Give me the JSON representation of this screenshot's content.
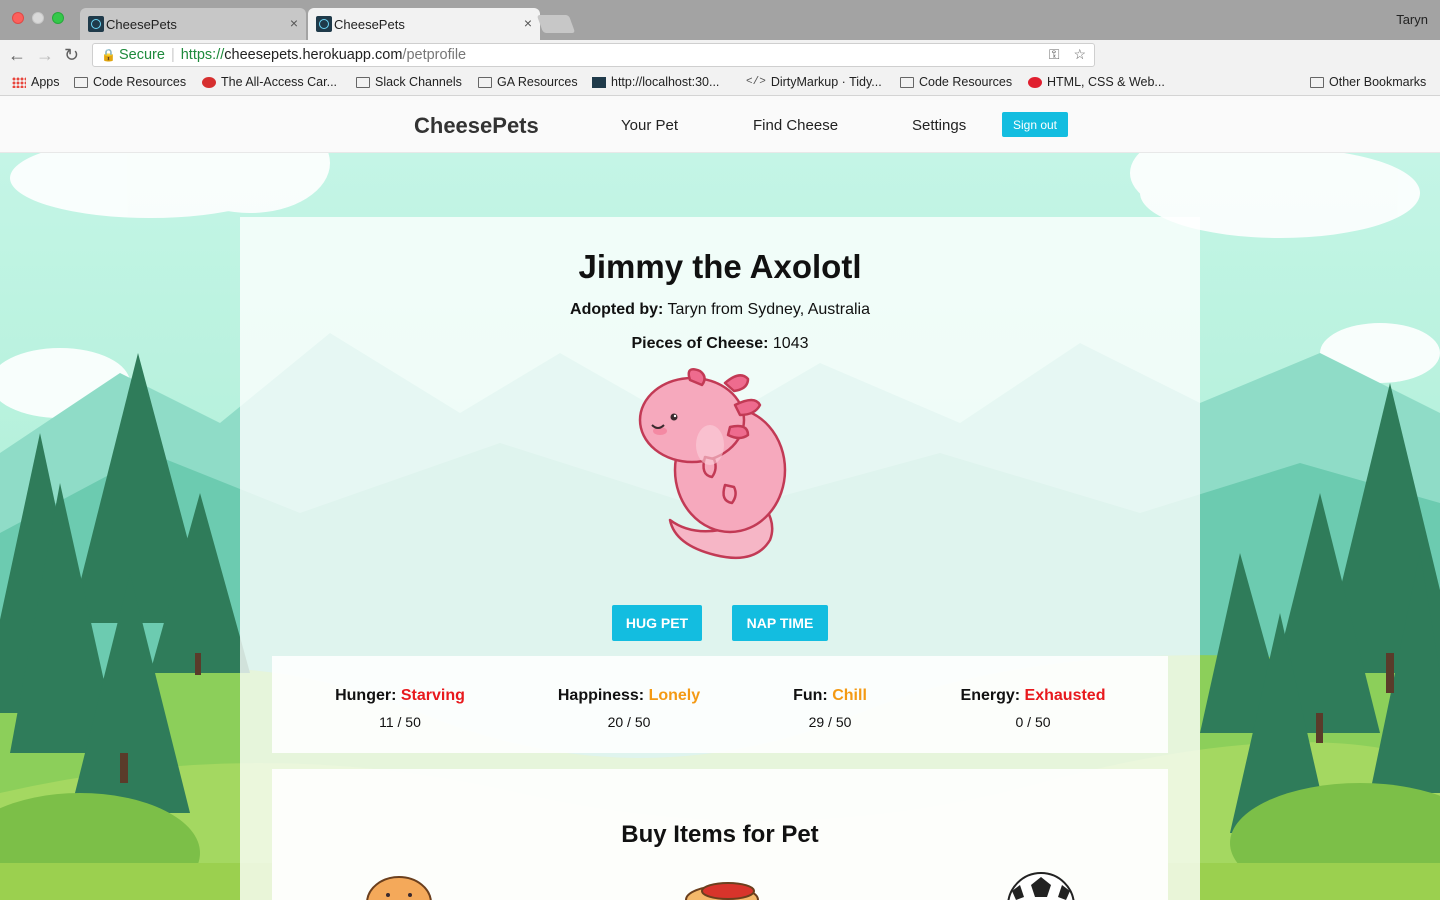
{
  "browser": {
    "tabs": [
      {
        "title": "CheesePets",
        "close": "×"
      },
      {
        "title": "CheesePets",
        "close": "×"
      }
    ],
    "profile_name": "Taryn",
    "address": {
      "secure_label": "Secure",
      "scheme": "https://",
      "host": "cheesepets.herokuapp.com",
      "path": "/petprofile"
    },
    "bookmarks": [
      {
        "label": "Apps",
        "icon": "apps-grid-icon"
      },
      {
        "label": "Code Resources",
        "icon": "folder-icon"
      },
      {
        "label": "The All-Access Car...",
        "icon": "site-icon"
      },
      {
        "label": "Slack Channels",
        "icon": "folder-icon"
      },
      {
        "label": "GA Resources",
        "icon": "folder-icon"
      },
      {
        "label": "http://localhost:30...",
        "icon": "react-icon"
      },
      {
        "label": "DirtyMarkup · Tidy...",
        "icon": "code-icon"
      },
      {
        "label": "Code Resources",
        "icon": "folder-icon"
      },
      {
        "label": "HTML, CSS & Web...",
        "icon": "site-icon"
      },
      {
        "label": "Other Bookmarks",
        "icon": "folder-icon"
      }
    ]
  },
  "nav": {
    "brand": "CheesePets",
    "links": [
      "Your Pet",
      "Find Cheese",
      "Settings"
    ],
    "signout_label": "Sign out",
    "accent": "#13bde0"
  },
  "pet": {
    "name": "Jimmy the Axolotl",
    "adopted_label": "Adopted by:",
    "adopted_value": "Taryn from Sydney, Australia",
    "cheese_label": "Pieces of Cheese:",
    "cheese_value": "1043",
    "image": "pink-axolotl-illustration"
  },
  "actions": {
    "hug_label": "HUG PET",
    "nap_label": "NAP TIME"
  },
  "stats": [
    {
      "label": "Hunger:",
      "status": "Starving",
      "value": "11 / 50",
      "status_color": "#e8191d"
    },
    {
      "label": "Happiness:",
      "status": "Lonely",
      "value": "20 / 50",
      "status_color": "#f49a14"
    },
    {
      "label": "Fun:",
      "status": "Chill",
      "value": "29 / 50",
      "status_color": "#f49a14"
    },
    {
      "label": "Energy:",
      "status": "Exhausted",
      "value": "0 / 50",
      "status_color": "#e8191d"
    }
  ],
  "shop": {
    "title": "Buy Items for Pet",
    "items": [
      "bread-icon",
      "hotdog-icon",
      "soccer-ball-icon"
    ]
  }
}
